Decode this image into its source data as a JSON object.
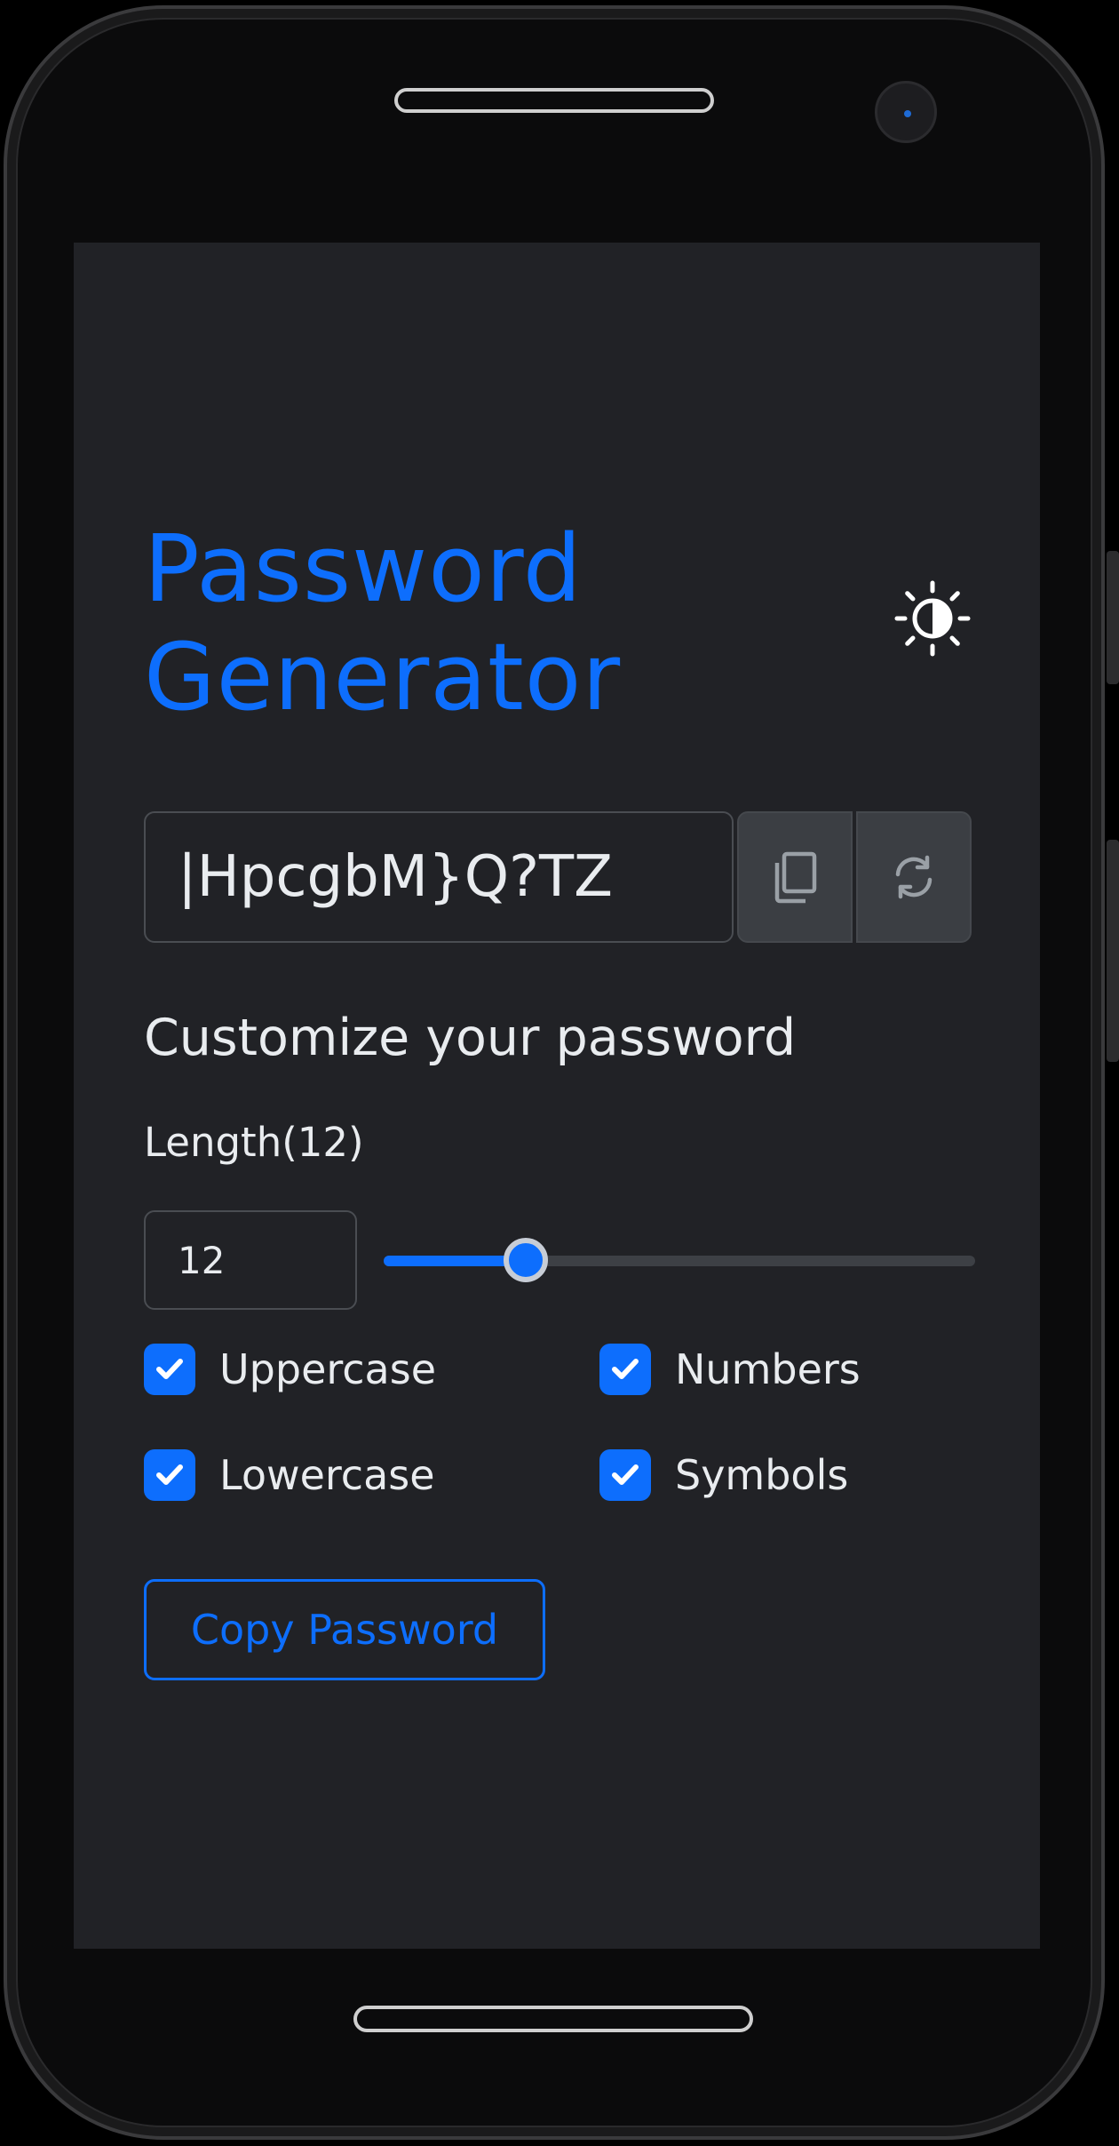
{
  "app": {
    "title": "Password Generator",
    "accent_color": "#0d6efd",
    "theme_toggle_icon": "contrast-sun-icon"
  },
  "password": {
    "value": "|HpcgbM}Q?TZ",
    "copy_icon": "copy-icon",
    "refresh_icon": "refresh-icon"
  },
  "customize": {
    "heading": "Customize your password",
    "length_label": "Length(12)",
    "length_value": "12",
    "length_numeric": 12,
    "length_fraction": 0.24
  },
  "options": [
    {
      "label": "Uppercase",
      "checked": true
    },
    {
      "label": "Numbers",
      "checked": true
    },
    {
      "label": "Lowercase",
      "checked": true
    },
    {
      "label": "Symbols",
      "checked": true
    }
  ],
  "actions": {
    "copy_password_label": "Copy Password"
  }
}
